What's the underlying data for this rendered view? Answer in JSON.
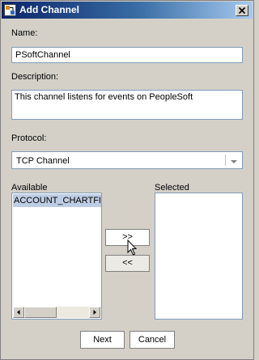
{
  "window": {
    "title": "Add Channel"
  },
  "form": {
    "name_label": "Name:",
    "name_value": "PSoftChannel",
    "description_label": "Description:",
    "description_value": "This channel listens for events on PeopleSoft",
    "protocol_label": "Protocol:",
    "protocol_value": "TCP Channel"
  },
  "lists": {
    "available_label": "Available",
    "available_items": [
      "ACCOUNT_CHARTFIELD"
    ],
    "selected_label": "Selected",
    "selected_items": []
  },
  "buttons": {
    "add": ">>",
    "remove": "<<",
    "next": "Next",
    "cancel": "Cancel"
  },
  "icons": {
    "window": "add-channel-icon",
    "close": "close-icon",
    "dropdown": "chevron-down-icon",
    "cursor": "mouse-pointer-icon"
  },
  "colors": {
    "titlebar_start": "#0a246a",
    "titlebar_end": "#a6caf0",
    "selection": "#bfcde4",
    "dialog_bg": "#d4d0c8"
  }
}
